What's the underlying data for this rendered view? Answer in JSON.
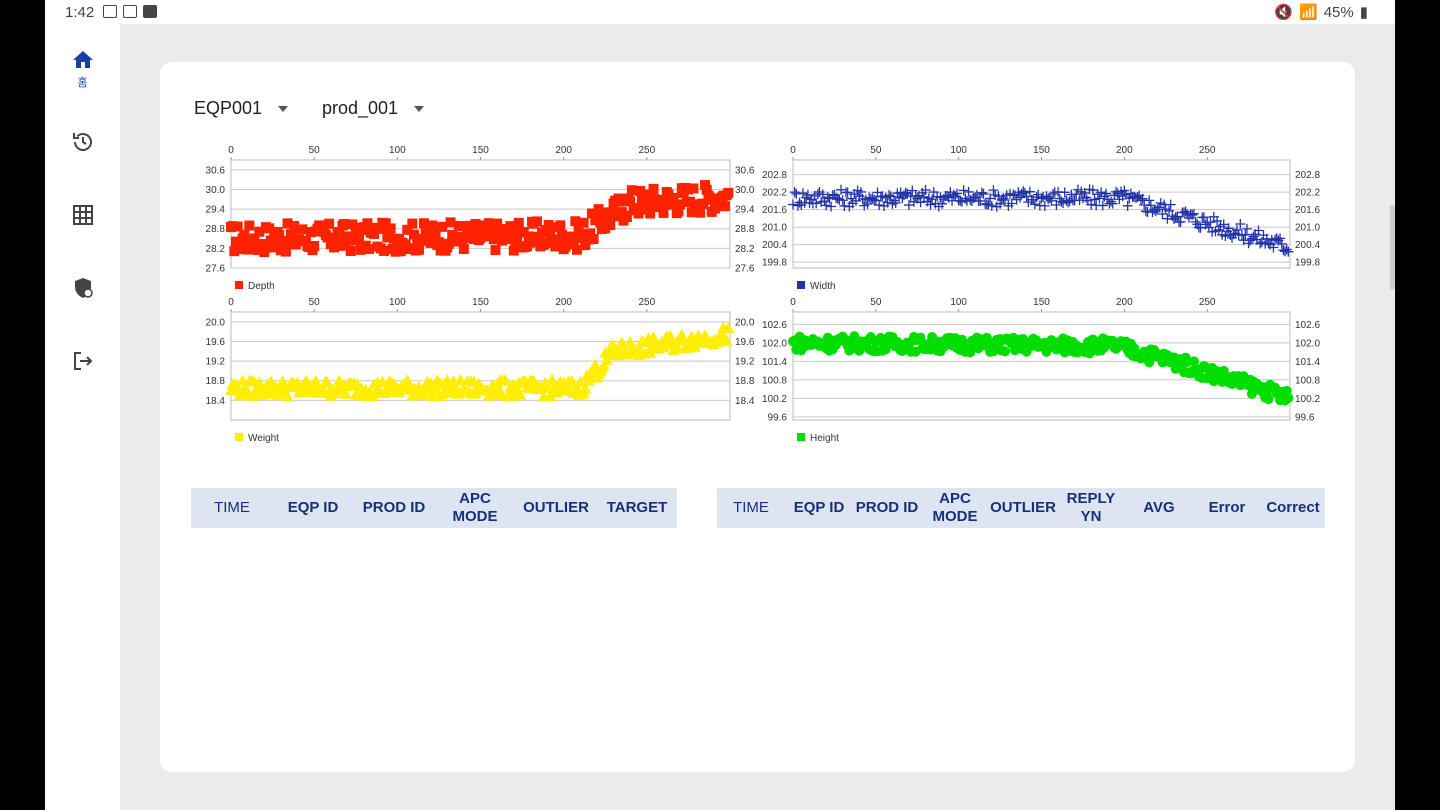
{
  "status_bar": {
    "time": "1:42",
    "battery": "45%"
  },
  "nav": {
    "items": [
      {
        "icon": "home-icon",
        "label": "홈"
      },
      {
        "icon": "history-icon"
      },
      {
        "icon": "grid-icon"
      },
      {
        "icon": "shield-icon"
      },
      {
        "icon": "logout-icon"
      }
    ]
  },
  "filters": {
    "equipment": "EQP001",
    "product": "prod_001"
  },
  "colors": {
    "depth": "#ff2200",
    "width": "#2233aa",
    "weight": "#ffee00",
    "height": "#00dd00",
    "accent": "#1a3fa0",
    "table_header": "#dde4f2"
  },
  "chart_data": [
    {
      "type": "scatter",
      "title": "",
      "legend": "Depth",
      "marker": "square",
      "xticks": [
        0,
        50,
        100,
        150,
        200,
        250
      ],
      "xlim": [
        0,
        300
      ],
      "yticks": [
        27.6,
        28.2,
        28.8,
        29.4,
        30.0,
        30.6
      ],
      "ylim": [
        27.6,
        30.9
      ],
      "grid": true,
      "trend": [
        [
          0,
          28.5
        ],
        [
          210,
          28.6
        ],
        [
          240,
          29.6
        ],
        [
          300,
          29.8
        ]
      ],
      "noise": 0.45,
      "n": 300
    },
    {
      "type": "scatter",
      "title": "",
      "legend": "Width",
      "marker": "plus",
      "xticks": [
        0,
        50,
        100,
        150,
        200,
        250
      ],
      "xlim": [
        0,
        300
      ],
      "yticks": [
        199.8,
        200.4,
        201.0,
        201.6,
        202.2,
        202.8
      ],
      "ylim": [
        199.6,
        203.3
      ],
      "grid": true,
      "trend": [
        [
          0,
          202.0
        ],
        [
          200,
          202.0
        ],
        [
          300,
          200.3
        ]
      ],
      "noise": 0.3,
      "n": 300
    },
    {
      "type": "scatter",
      "title": "",
      "legend": "Weight",
      "marker": "triangle",
      "xticks": [
        0,
        50,
        100,
        150,
        200,
        250
      ],
      "xlim": [
        0,
        300
      ],
      "yticks": [
        18.4,
        18.8,
        19.2,
        19.6,
        20.0
      ],
      "ylim": [
        18.0,
        20.2
      ],
      "grid": true,
      "trend": [
        [
          0,
          18.65
        ],
        [
          210,
          18.65
        ],
        [
          230,
          19.4
        ],
        [
          300,
          19.75
        ]
      ],
      "noise": 0.17,
      "n": 300
    },
    {
      "type": "scatter",
      "title": "",
      "legend": "Height",
      "marker": "circle",
      "xticks": [
        0,
        50,
        100,
        150,
        200,
        250
      ],
      "xlim": [
        0,
        300
      ],
      "yticks": [
        99.6,
        100.2,
        100.8,
        101.4,
        102.0,
        102.6
      ],
      "ylim": [
        99.5,
        103.0
      ],
      "grid": true,
      "trend": [
        [
          0,
          102.0
        ],
        [
          195,
          101.9
        ],
        [
          230,
          101.4
        ],
        [
          300,
          100.2
        ]
      ],
      "noise": 0.25,
      "n": 300
    }
  ],
  "table_left": {
    "headers": [
      "TIME",
      "EQP ID",
      "PROD ID",
      "APC MODE",
      "OUTLIER",
      "TARGET"
    ]
  },
  "table_right": {
    "headers": [
      "TIME",
      "EQP ID",
      "PROD ID",
      "APC\nMODE",
      "OUTLIER",
      "REPLY\nYN",
      "AVG",
      "Error",
      "Correct"
    ]
  }
}
